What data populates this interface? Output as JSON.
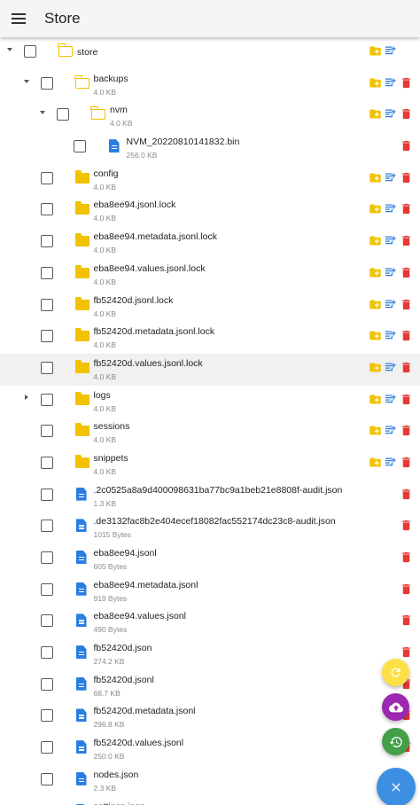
{
  "app": {
    "title": "Store"
  },
  "icons": {
    "menu": "hamburger-menu-icon",
    "new_folder": "folder-plus-icon",
    "new_file": "note-plus-icon",
    "delete": "trash-icon"
  },
  "colors": {
    "folder": "#f2c200",
    "file": "#2a7de1",
    "delete": "#e53935",
    "fab_refresh": "#fde047",
    "fab_upload": "#9c27b0",
    "fab_history": "#43a047",
    "fab_close": "#3d8fe3"
  },
  "tree": [
    {
      "name": "store",
      "size": "",
      "kind": "folder-open",
      "level": 0,
      "toggle": "expanded",
      "actions": [
        "new_folder",
        "new_file"
      ]
    },
    {
      "name": "backups",
      "size": "4.0 KB",
      "kind": "folder-open",
      "level": 1,
      "toggle": "expanded",
      "actions": [
        "new_folder",
        "new_file",
        "delete"
      ]
    },
    {
      "name": "nvm",
      "size": "4.0 KB",
      "kind": "folder-open",
      "level": 2,
      "toggle": "expanded",
      "actions": [
        "new_folder",
        "new_file",
        "delete"
      ]
    },
    {
      "name": "NVM_20220810141832.bin",
      "size": "256.0 KB",
      "kind": "file",
      "level": 3,
      "toggle": "none",
      "actions": [
        "delete"
      ]
    },
    {
      "name": "config",
      "size": "4.0 KB",
      "kind": "folder-closed",
      "level": 1,
      "toggle": "none",
      "actions": [
        "new_folder",
        "new_file",
        "delete"
      ]
    },
    {
      "name": "eba8ee94.jsonl.lock",
      "size": "4.0 KB",
      "kind": "folder-closed",
      "level": 1,
      "toggle": "none",
      "actions": [
        "new_folder",
        "new_file",
        "delete"
      ]
    },
    {
      "name": "eba8ee94.metadata.jsonl.lock",
      "size": "4.0 KB",
      "kind": "folder-closed",
      "level": 1,
      "toggle": "none",
      "actions": [
        "new_folder",
        "new_file",
        "delete"
      ]
    },
    {
      "name": "eba8ee94.values.jsonl.lock",
      "size": "4.0 KB",
      "kind": "folder-closed",
      "level": 1,
      "toggle": "none",
      "actions": [
        "new_folder",
        "new_file",
        "delete"
      ]
    },
    {
      "name": "fb52420d.jsonl.lock",
      "size": "4.0 KB",
      "kind": "folder-closed",
      "level": 1,
      "toggle": "none",
      "actions": [
        "new_folder",
        "new_file",
        "delete"
      ]
    },
    {
      "name": "fb52420d.metadata.jsonl.lock",
      "size": "4.0 KB",
      "kind": "folder-closed",
      "level": 1,
      "toggle": "none",
      "actions": [
        "new_folder",
        "new_file",
        "delete"
      ]
    },
    {
      "name": "fb52420d.values.jsonl.lock",
      "size": "4.0 KB",
      "kind": "folder-closed",
      "level": 1,
      "toggle": "none",
      "actions": [
        "new_folder",
        "new_file",
        "delete"
      ],
      "highlighted": true
    },
    {
      "name": "logs",
      "size": "4.0 KB",
      "kind": "folder-closed",
      "level": 1,
      "toggle": "collapsed",
      "actions": [
        "new_folder",
        "new_file",
        "delete"
      ]
    },
    {
      "name": "sessions",
      "size": "4.0 KB",
      "kind": "folder-closed",
      "level": 1,
      "toggle": "none",
      "actions": [
        "new_folder",
        "new_file",
        "delete"
      ]
    },
    {
      "name": "snippets",
      "size": "4.0 KB",
      "kind": "folder-closed",
      "level": 1,
      "toggle": "none",
      "actions": [
        "new_folder",
        "new_file",
        "delete"
      ]
    },
    {
      "name": ".2c0525a8a9d400098631ba77bc9a1beb21e8808f-audit.json",
      "size": "1.3 KB",
      "kind": "file",
      "level": 1,
      "toggle": "none",
      "actions": [
        "delete"
      ]
    },
    {
      "name": ".de3132fac8b2e404ecef18082fac552174dc23c8-audit.json",
      "size": "1015 Bytes",
      "kind": "file",
      "level": 1,
      "toggle": "none",
      "actions": [
        "delete"
      ]
    },
    {
      "name": "eba8ee94.jsonl",
      "size": "605 Bytes",
      "kind": "file",
      "level": 1,
      "toggle": "none",
      "actions": [
        "delete"
      ]
    },
    {
      "name": "eba8ee94.metadata.jsonl",
      "size": "919 Bytes",
      "kind": "file",
      "level": 1,
      "toggle": "none",
      "actions": [
        "delete"
      ]
    },
    {
      "name": "eba8ee94.values.jsonl",
      "size": "490 Bytes",
      "kind": "file",
      "level": 1,
      "toggle": "none",
      "actions": [
        "delete"
      ]
    },
    {
      "name": "fb52420d.json",
      "size": "274.2 KB",
      "kind": "file",
      "level": 1,
      "toggle": "none",
      "actions": [
        "delete"
      ]
    },
    {
      "name": "fb52420d.jsonl",
      "size": "68.7 KB",
      "kind": "file",
      "level": 1,
      "toggle": "none",
      "actions": [
        "delete"
      ]
    },
    {
      "name": "fb52420d.metadata.jsonl",
      "size": "296.8 KB",
      "kind": "file",
      "level": 1,
      "toggle": "none",
      "actions": [
        "delete"
      ]
    },
    {
      "name": "fb52420d.values.jsonl",
      "size": "250.0 KB",
      "kind": "file",
      "level": 1,
      "toggle": "none",
      "actions": [
        "delete"
      ]
    },
    {
      "name": "nodes.json",
      "size": "2.3 KB",
      "kind": "file",
      "level": 1,
      "toggle": "none",
      "actions": [
        "delete"
      ]
    },
    {
      "name": "settings.json",
      "size": "",
      "kind": "file",
      "level": 1,
      "toggle": "none",
      "actions": [
        "delete"
      ],
      "clipped": true
    }
  ],
  "fabs": [
    {
      "id": "refresh",
      "icon": "refresh-icon"
    },
    {
      "id": "upload",
      "icon": "cloud-upload-icon"
    },
    {
      "id": "history",
      "icon": "history-icon"
    },
    {
      "id": "close",
      "icon": "close-icon"
    }
  ]
}
